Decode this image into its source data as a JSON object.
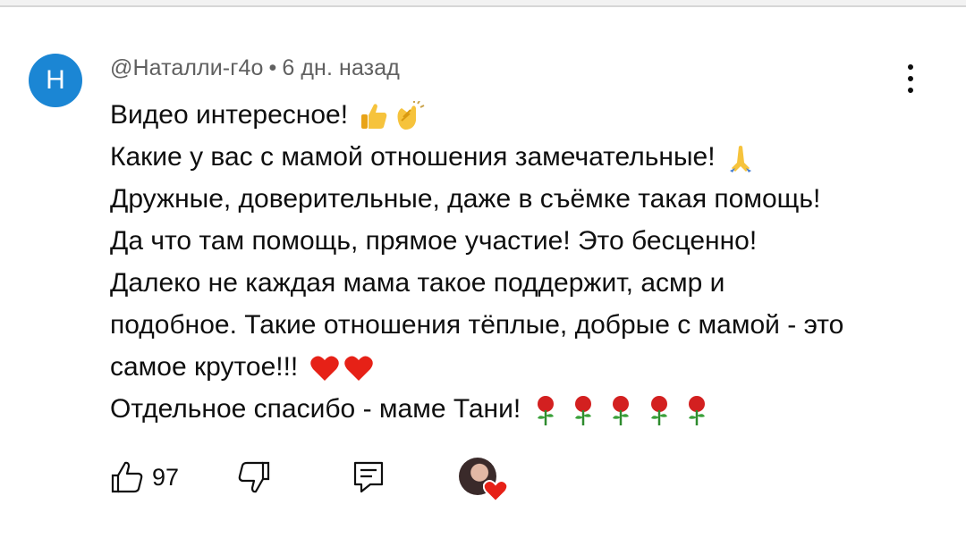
{
  "comment": {
    "avatar_letter": "Н",
    "author": "@Наталли-г4о",
    "separator": "•",
    "time": "6 дн. назад",
    "lines": [
      "Видео интересное!",
      "Какие у вас с мамой отношения замечательные!",
      "Дружные, доверительные, даже в съёмке такая помощь!",
      "Да что там помощь, прямое участие! Это бесценно!",
      "Далеко не каждая мама такое поддержит, асмр и",
      "подобное. Такие отношения тёплые, добрые с мамой - это",
      "самое крутое!!!",
      "Отдельное спасибо - маме Тани!"
    ],
    "emojis": {
      "line0": [
        "thumbs-up",
        "clapping-hands"
      ],
      "line1": [
        "folded-hands"
      ],
      "line6": [
        "red-heart",
        "red-heart"
      ],
      "line7": [
        "rose",
        "rose",
        "rose",
        "rose",
        "rose"
      ]
    }
  },
  "actions": {
    "like_count": "97",
    "icons": [
      "thumbs-up-outline-icon",
      "thumbs-down-outline-icon",
      "reply-comment-icon",
      "creator-heart-icon"
    ]
  },
  "colors": {
    "avatar_bg": "#1b86d4",
    "meta_text": "#606060",
    "body_text": "#0f0f0f",
    "heart": "#e62117"
  }
}
